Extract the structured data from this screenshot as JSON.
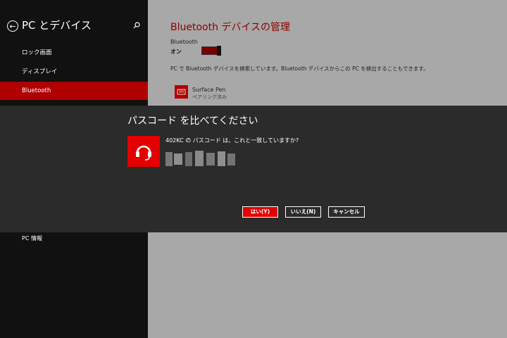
{
  "sidebar": {
    "title": "PC とデバイス",
    "items": [
      {
        "label": "ロック画面"
      },
      {
        "label": "ディスプレイ"
      },
      {
        "label": "Bluetooth"
      }
    ],
    "lower_item": "PC 情報"
  },
  "main": {
    "title": "Bluetooth デバイスの管理",
    "bt_label": "Bluetooth",
    "bt_state": "オン",
    "description": "PC で Bluetooth デバイスを検索しています。Bluetooth デバイスからこの PC を検出することもできます。",
    "device": {
      "name": "Surface Pen",
      "status": "ペアリング済み"
    }
  },
  "dialog": {
    "title": "パスコード を比べてください",
    "question": "402KC の パスコード は、これと一致していますか?",
    "buttons": {
      "yes": "はい(Y)",
      "no": "いいえ(N)",
      "cancel": "キャンセル"
    }
  },
  "colors": {
    "accent": "#e40000",
    "title_red": "#8a0000",
    "selected": "#b00000",
    "sidebar_bg": "#111111",
    "dialog_bg": "#2b2b2b"
  },
  "icons": [
    "back-arrow-icon",
    "search-icon",
    "pen-device-icon",
    "headset-icon"
  ]
}
